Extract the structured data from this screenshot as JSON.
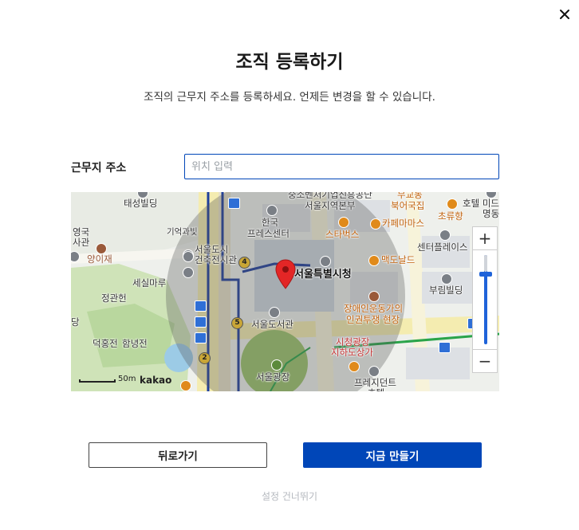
{
  "dialog": {
    "title": "조직 등록하기",
    "subtitle": "조직의 근무지 주소를 등록하세요. 언제든 변경을 할 수 있습니다.",
    "close_icon": "close-icon"
  },
  "address": {
    "label": "근무지 주소",
    "value": "",
    "placeholder": "위치 입력"
  },
  "map": {
    "provider": "kakao",
    "scale_label": "50m",
    "marker_label": "서울특별시청",
    "labels": {
      "taeseong": "태성빌딩",
      "yeonggook": "영국",
      "sagwan": "사관",
      "yangijae": "양이재",
      "giyeok": "기억과빛",
      "seoulcity_arch": "서울도시",
      "arch_hall": "건축전시관",
      "sesil": "세실마루",
      "jeonggwanheon": "정관헌",
      "dang": "당",
      "deokhongjeon": "덕홍전",
      "hamnyeongjeon": "함녕전",
      "sme": "중소벤처기업진흥공단",
      "regional_hq": "서울지역본부",
      "korea": "한국",
      "press_center": "프레스센터",
      "starbucks": "스타벅스",
      "caffe_mamas": "카페마마스",
      "bukchang": "북어국집",
      "mukyo": "무교동",
      "chouryu": "초류향",
      "hotel": "호텔 미드",
      "myeongdong": "명동",
      "center_place": "센터플레이스",
      "mcdonalds": "맥도날드",
      "burim": "부림빌딩",
      "disability": "장애인운동가의",
      "rights": "인권투쟁 현장",
      "library": "서울도서관",
      "plaza_mall": "시청광장",
      "underground_mall": "지하도상가",
      "seoul_plaza": "서울광장",
      "president": "프레지던트",
      "hotel2": "호텔"
    },
    "subway_numbers": [
      "4",
      "5",
      "2"
    ],
    "colors": {
      "radius_fill": "#555555",
      "marker": "#e32626",
      "line_blue": "#1f3f9c",
      "line_green": "#2aa44a",
      "road_yellow": "#f4ecb0"
    },
    "zoom": {
      "in_label": "+",
      "out_label": "−",
      "level": 0.2,
      "zoom_in_icon": "zoom-in-icon",
      "zoom_out_icon": "zoom-out-icon"
    }
  },
  "actions": {
    "back_label": "뒤로가기",
    "create_label": "지금 만들기",
    "skip_label": "설정 건너뛰기"
  },
  "theme": {
    "primary": "#0046b8",
    "input_border": "#0046b8",
    "skip_text": "#b4b8be"
  }
}
